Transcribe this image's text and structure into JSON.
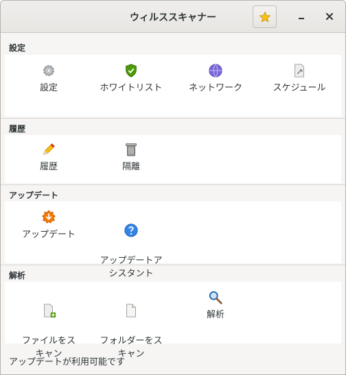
{
  "window": {
    "title": "ウィルススキャナー"
  },
  "sections": {
    "settings": {
      "heading": "設定",
      "items": [
        "設定",
        "ホワイトリスト",
        "ネットワーク",
        "スケジュール"
      ]
    },
    "history": {
      "heading": "履歴",
      "items": [
        "履歴",
        "隔離"
      ]
    },
    "update": {
      "heading": "アップデート",
      "items": [
        "アップデート",
        "アップデートア\nシスタント"
      ]
    },
    "analysis": {
      "heading": "解析",
      "items": [
        "ファイルをス\nキャン",
        "フォルダーをス\nキャン",
        "解析"
      ]
    }
  },
  "status": "アップデートが利用可能です",
  "colors": {
    "accent_star": "#f5c211",
    "shield_green": "#4e9a06",
    "network_purple": "#7b68d8",
    "update_orange": "#f57900",
    "help_blue": "#3584e4"
  }
}
